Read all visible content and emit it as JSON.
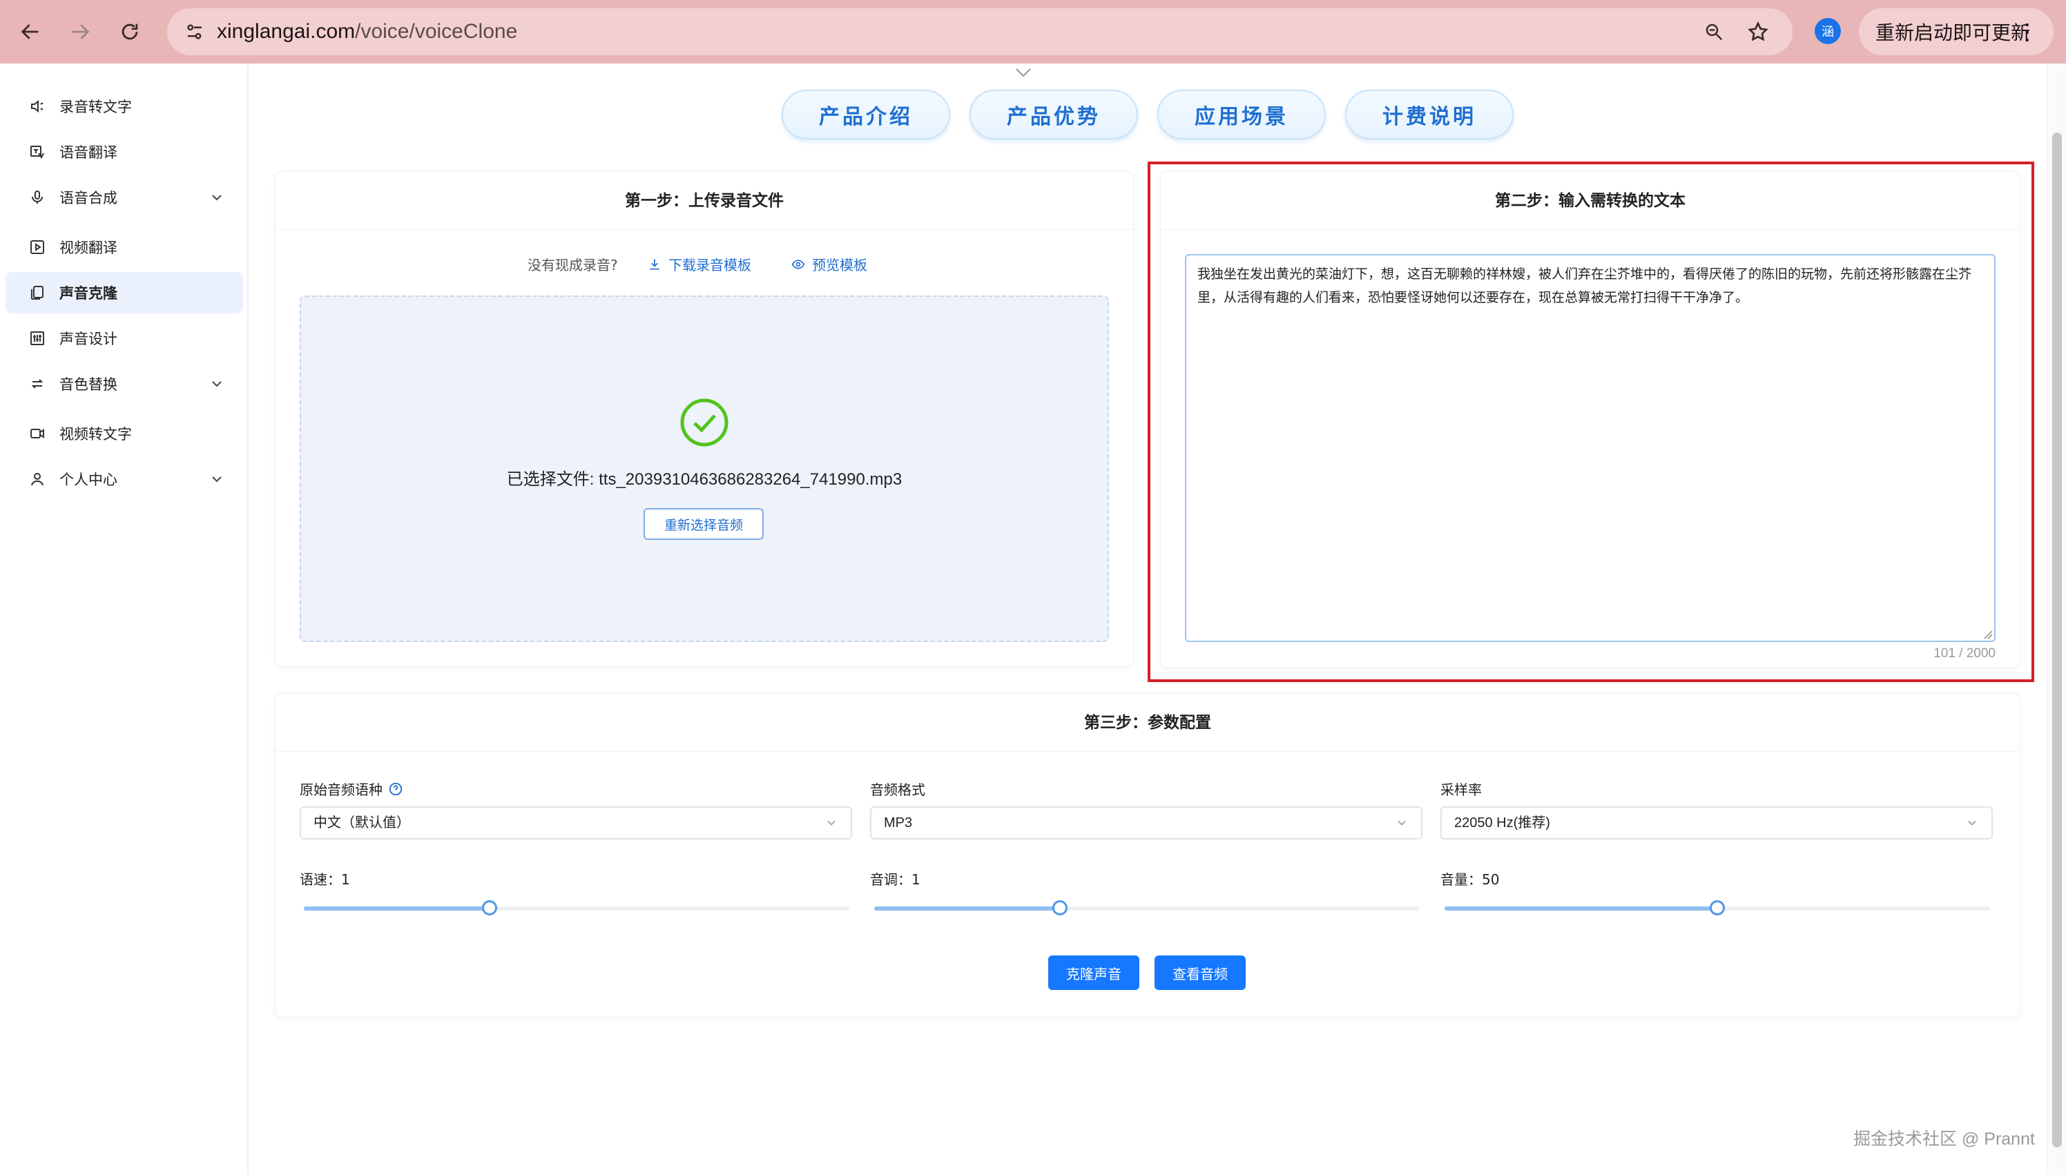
{
  "browser": {
    "url_host": "xinglangai.com",
    "url_path": "/voice/voiceClone",
    "profile_initial": "涵",
    "update_label": "重新启动即可更新",
    "menu_glyph": "⋮"
  },
  "sidebar": {
    "items": [
      {
        "label": "录音转文字",
        "icon": "speaker-icon",
        "has_children": false,
        "active": false
      },
      {
        "label": "语音翻译",
        "icon": "translate-icon",
        "has_children": false,
        "active": false
      },
      {
        "label": "语音合成",
        "icon": "microphone-icon",
        "has_children": true,
        "active": false
      },
      {
        "label": "视频翻译",
        "icon": "video-play-icon",
        "has_children": false,
        "active": false
      },
      {
        "label": "声音克隆",
        "icon": "copy-icon",
        "has_children": false,
        "active": true
      },
      {
        "label": "声音设计",
        "icon": "equalizer-icon",
        "has_children": false,
        "active": false
      },
      {
        "label": "音色替换",
        "icon": "swap-icon",
        "has_children": true,
        "active": false
      },
      {
        "label": "视频转文字",
        "icon": "video-camera-icon",
        "has_children": false,
        "active": false
      },
      {
        "label": "个人中心",
        "icon": "user-icon",
        "has_children": true,
        "active": false
      }
    ]
  },
  "tabs": [
    "产品介绍",
    "产品优势",
    "应用场景",
    "计费说明"
  ],
  "step1": {
    "title": "第一步：上传录音文件",
    "hint": "没有现成录音?",
    "download_label": "下载录音模板",
    "preview_label": "预览模板",
    "selected_file": "已选择文件: tts_2039310463686283264_741990.mp3",
    "reselect_label": "重新选择音频"
  },
  "step2": {
    "title": "第二步：输入需转换的文本",
    "text": "我独坐在发出黄光的菜油灯下，想，这百无聊赖的祥林嫂，被人们弃在尘芥堆中的，看得厌倦了的陈旧的玩物，先前还将形骸露在尘芥里，从活得有趣的人们看来，恐怕要怪讶她何以还要存在，现在总算被无常打扫得干干净净了。",
    "char_count": "101 / 2000"
  },
  "step3": {
    "title": "第三步：参数配置",
    "language_label": "原始音频语种",
    "language_value": "中文（默认值）",
    "format_label": "音频格式",
    "format_value": "MP3",
    "samplerate_label": "采样率",
    "samplerate_value": "22050 Hz(推荐)",
    "speed_label": "语速：1",
    "speed_fraction": 0.34,
    "pitch_label": "音调：1",
    "pitch_fraction": 0.34,
    "volume_label": "音量：50",
    "volume_fraction": 0.5,
    "clone_button": "克隆声音",
    "view_button": "查看音频"
  },
  "watermark": "掘金技术社区 @ Prannt",
  "colors": {
    "accent": "#1677ff",
    "highlight": "#d32026",
    "success": "#52c41a",
    "chrome": "#e9b6b8"
  }
}
